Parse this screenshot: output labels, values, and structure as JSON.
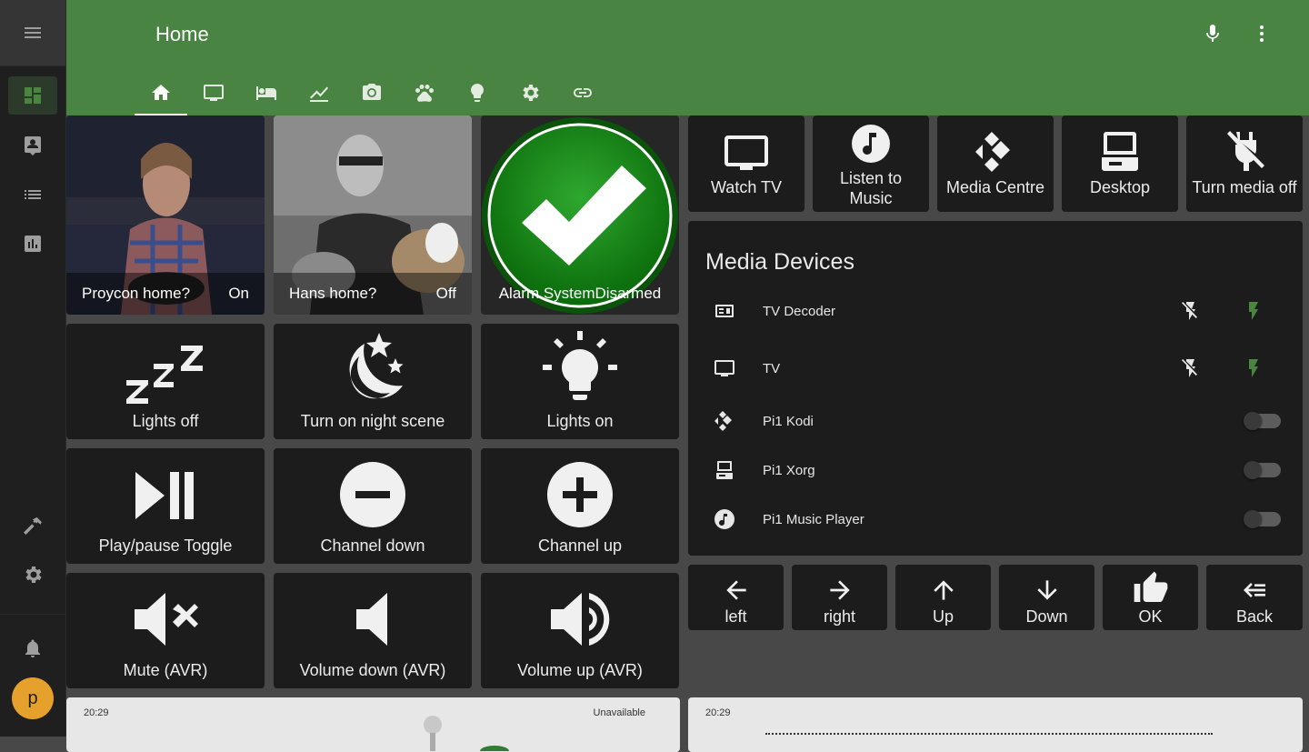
{
  "header": {
    "title": "Home"
  },
  "cards": {
    "proycon": {
      "name": "Proycon home?",
      "state": "On"
    },
    "hans": {
      "name": "Hans home?",
      "state": "Off"
    },
    "alarm": {
      "name": "Alarm System",
      "state": "Disarmed"
    },
    "lights_off": "Lights off",
    "night_scene": "Turn on night scene",
    "lights_on": "Lights on",
    "play_pause": "Play/pause Toggle",
    "channel_down": "Channel down",
    "channel_up": "Channel up",
    "mute": "Mute (AVR)",
    "vol_down": "Volume down (AVR)",
    "vol_up": "Volume up (AVR)"
  },
  "media_buttons": {
    "watch_tv": "Watch TV",
    "listen_music": "Listen to Music",
    "media_centre": "Media Centre",
    "desktop": "Desktop",
    "media_off": "Turn media off"
  },
  "media_devices": {
    "title": "Media Devices",
    "items": [
      {
        "name": "TV Decoder",
        "control": "power-buttons"
      },
      {
        "name": "TV",
        "control": "power-buttons"
      },
      {
        "name": "Pi1 Kodi",
        "control": "toggle-off"
      },
      {
        "name": "Pi1 Xorg",
        "control": "toggle-off"
      },
      {
        "name": "Pi1 Music Player",
        "control": "toggle-off"
      }
    ]
  },
  "remote": {
    "left": "left",
    "right": "right",
    "up": "Up",
    "down": "Down",
    "ok": "OK",
    "back": "Back"
  },
  "bottom": {
    "left_time": "20:29",
    "left_status": "Unavailable",
    "right_time": "20:29"
  },
  "user": {
    "initial": "p"
  },
  "colors": {
    "header": "#4a8442",
    "accent_power": "#4a8640",
    "avatar": "#e6a12c"
  }
}
